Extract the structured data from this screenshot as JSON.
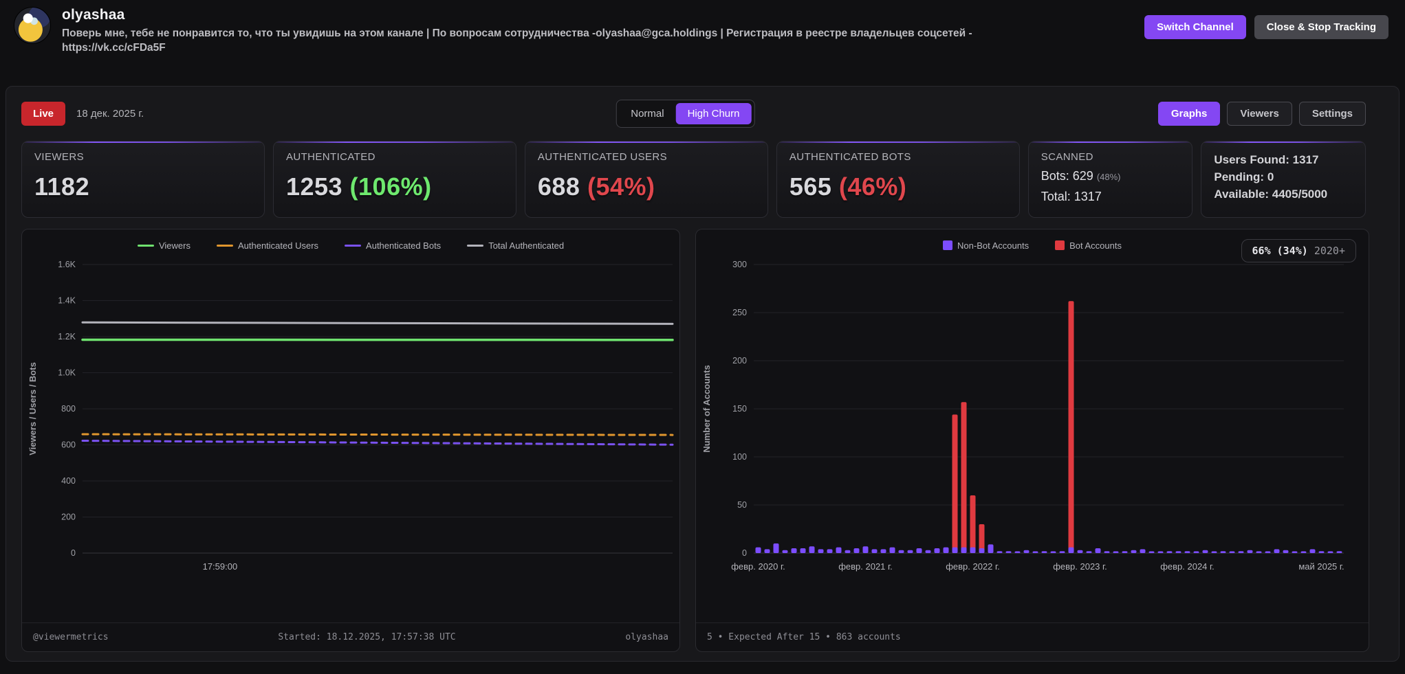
{
  "header": {
    "channel_name": "olyashaa",
    "description_line1": "Поверь мне, тебе не понравится то, что ты увидишь на этом канале | По вопросам сотрудничества -olyashaa@gca.holdings | Регистрация в реестре владельцев соцсетей -",
    "description_line2": "https://vk.cc/cFDa5F",
    "switch_channel_label": "Switch Channel",
    "close_label": "Close & Stop Tracking"
  },
  "controls": {
    "live_label": "Live",
    "date_label": "18 дек. 2025 г.",
    "mode_normal": "Normal",
    "mode_high_churn": "High Churn",
    "tab_graphs": "Graphs",
    "tab_viewers": "Viewers",
    "tab_settings": "Settings"
  },
  "stats": {
    "viewers": {
      "label": "VIEWERS",
      "value": "1182"
    },
    "authenticated": {
      "label": "AUTHENTICATED",
      "value": "1253 ",
      "percent": "(106%)"
    },
    "auth_users": {
      "label": "AUTHENTICATED USERS",
      "value": "688 ",
      "percent": "(54%)"
    },
    "auth_bots": {
      "label": "AUTHENTICATED BOTS",
      "value": "565 ",
      "percent": "(46%)"
    },
    "scanned": {
      "label": "SCANNED",
      "bots_text": "Bots: 629 ",
      "bots_percent": "(48%)",
      "total_text": "Total: 1317"
    },
    "quota": {
      "users_found": "Users Found: 1317",
      "pending": "Pending: 0",
      "available": "Available: 4405/5000"
    }
  },
  "left_footer": {
    "handle": "@viewermetrics",
    "started": "Started: 18.12.2025, 17:57:38 UTC",
    "channel": "olyashaa"
  },
  "right_footer": {
    "text": "5 • Expected After 15 • 863 accounts"
  },
  "right_badge": {
    "percent": "66% (34%)",
    "suffix": " 2020+"
  },
  "colors": {
    "accent_purple": "#8447f3",
    "live_red": "#c8262c",
    "percent_green": "#6ee96e",
    "percent_red": "#e0474d"
  },
  "chart_data": [
    {
      "type": "line",
      "ylabel": "Viewers / Users / Bots",
      "ylim": [
        0,
        1600
      ],
      "yticks": [
        {
          "v": 1600,
          "label": "1.6K"
        },
        {
          "v": 1400,
          "label": "1.4K"
        },
        {
          "v": 1200,
          "label": "1.2K"
        },
        {
          "v": 1000,
          "label": "1.0K"
        },
        {
          "v": 800,
          "label": "800"
        },
        {
          "v": 600,
          "label": "600"
        },
        {
          "v": 400,
          "label": "400"
        },
        {
          "v": 200,
          "label": "200"
        },
        {
          "v": 0,
          "label": "0"
        }
      ],
      "xticks": [
        {
          "pos": 0.233,
          "label": "17:59:00"
        }
      ],
      "grid": true,
      "legend_position": "top",
      "series": [
        {
          "name": "Viewers",
          "color": "#6fe26f",
          "dash": false,
          "width": 3.5,
          "values": [
            1183,
            1182
          ]
        },
        {
          "name": "Authenticated Users",
          "color": "#e0962e",
          "dash": true,
          "width": 3,
          "values": [
            659,
            655
          ]
        },
        {
          "name": "Authenticated Bots",
          "color": "#7a52f0",
          "dash": true,
          "width": 3,
          "values": [
            623,
            601
          ]
        },
        {
          "name": "Total Authenticated",
          "color": "#b3b3bb",
          "dash": false,
          "width": 3,
          "values": [
            1279,
            1271
          ]
        }
      ]
    },
    {
      "type": "bar",
      "ylabel": "Number of Accounts",
      "ylim": [
        0,
        300
      ],
      "yticks": [
        {
          "v": 300,
          "label": "300"
        },
        {
          "v": 250,
          "label": "250"
        },
        {
          "v": 200,
          "label": "200"
        },
        {
          "v": 150,
          "label": "150"
        },
        {
          "v": 100,
          "label": "100"
        },
        {
          "v": 50,
          "label": "50"
        },
        {
          "v": 0,
          "label": "0"
        }
      ],
      "grid": true,
      "categories_note": "monthly account-creation dates, Feb 2020 - Jul 2025",
      "xticks": [
        {
          "index": 0,
          "label": "февр. 2020 г."
        },
        {
          "index": 12,
          "label": "февр. 2021 г."
        },
        {
          "index": 24,
          "label": "февр. 2022 г."
        },
        {
          "index": 36,
          "label": "февр. 2023 г."
        },
        {
          "index": 48,
          "label": "февр. 2024 г."
        },
        {
          "index": 63,
          "label": "май 2025 г."
        }
      ],
      "legend_position": "top",
      "series_legend": [
        {
          "name": "Non-Bot Accounts",
          "color": "#7c4dff"
        },
        {
          "name": "Bot Accounts",
          "color": "#e03a40"
        }
      ],
      "bars_format": "[non_bot_accounts, bot_accounts] per month",
      "bars": [
        [
          6,
          0
        ],
        [
          4,
          0
        ],
        [
          10,
          0
        ],
        [
          3,
          0
        ],
        [
          5,
          0
        ],
        [
          5,
          0
        ],
        [
          7,
          0
        ],
        [
          4,
          0
        ],
        [
          4,
          0
        ],
        [
          6,
          0
        ],
        [
          3,
          0
        ],
        [
          5,
          0
        ],
        [
          7,
          0
        ],
        [
          4,
          0
        ],
        [
          4,
          0
        ],
        [
          6,
          0
        ],
        [
          3,
          0
        ],
        [
          3,
          0
        ],
        [
          5,
          0
        ],
        [
          3,
          0
        ],
        [
          5,
          0
        ],
        [
          6,
          0
        ],
        [
          6,
          144
        ],
        [
          6,
          157
        ],
        [
          6,
          60
        ],
        [
          5,
          30
        ],
        [
          9,
          0
        ],
        [
          2,
          0
        ],
        [
          2,
          0
        ],
        [
          1,
          0
        ],
        [
          3,
          0
        ],
        [
          1,
          0
        ],
        [
          2,
          0
        ],
        [
          1,
          0
        ],
        [
          2,
          0
        ],
        [
          6,
          262
        ],
        [
          3,
          0
        ],
        [
          2,
          0
        ],
        [
          5,
          0
        ],
        [
          2,
          0
        ],
        [
          1,
          0
        ],
        [
          2,
          0
        ],
        [
          3,
          0
        ],
        [
          4,
          0
        ],
        [
          1,
          0
        ],
        [
          1,
          0
        ],
        [
          2,
          0
        ],
        [
          2,
          0
        ],
        [
          2,
          0
        ],
        [
          1,
          0
        ],
        [
          3,
          0
        ],
        [
          1,
          0
        ],
        [
          2,
          0
        ],
        [
          1,
          0
        ],
        [
          2,
          0
        ],
        [
          3,
          0
        ],
        [
          1,
          0
        ],
        [
          1,
          0
        ],
        [
          4,
          0
        ],
        [
          3,
          0
        ],
        [
          1,
          0
        ],
        [
          1,
          0
        ],
        [
          4,
          0
        ],
        [
          2,
          0
        ],
        [
          1,
          0
        ],
        [
          2,
          0
        ]
      ]
    }
  ]
}
